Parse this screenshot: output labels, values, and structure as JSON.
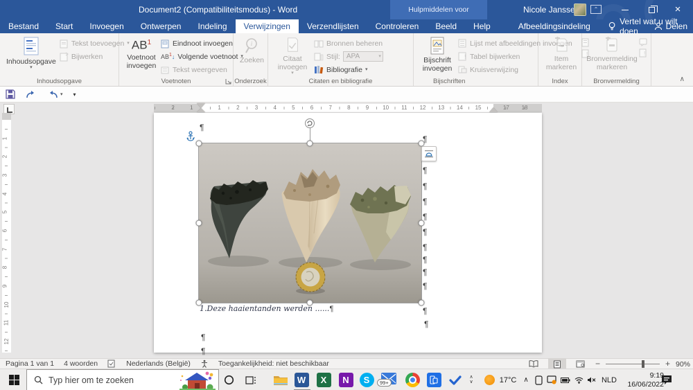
{
  "titlebar": {
    "title": "Document2 (Compatibiliteitsmodus)  -  Word",
    "context": "Hulpmiddelen voor afbeeldingen",
    "user": "Nicole Janssens"
  },
  "tabs": [
    "Bestand",
    "Start",
    "Invoegen",
    "Ontwerpen",
    "Indeling",
    "Verwijzingen",
    "Verzendlijsten",
    "Controleren",
    "Beeld",
    "Help",
    "Afbeeldingsindeling"
  ],
  "tellme": "Vertel wat u wilt doen",
  "share": "Delen",
  "ribbon": {
    "toc": {
      "main": "Inhoudsopgave",
      "add": "Tekst toevoegen",
      "update": "Bijwerken",
      "label": "Inhoudsopgave"
    },
    "fn": {
      "ab": "AB",
      "sup": "1",
      "main": "Voetnoot invoegen",
      "endnote": "Eindnoot invoegen",
      "next": "Volgende voetnoot",
      "show": "Tekst weergeven",
      "label": "Voetnoten"
    },
    "research": {
      "main": "Zoeken",
      "label": "Onderzoek"
    },
    "cit": {
      "main": "Citaat invoegen",
      "manage": "Bronnen beheren",
      "style": "Stijl:",
      "style_value": "APA",
      "biblio": "Bibliografie",
      "label": "Citaten en bibliografie"
    },
    "cap": {
      "main": "Bijschrift invoegen",
      "list": "Lijst met afbeeldingen invoegen",
      "update": "Tabel bijwerken",
      "cross": "Kruisverwijzing",
      "label": "Bijschriften"
    },
    "index": {
      "main": "Item markeren",
      "label": "Index"
    },
    "source": {
      "main": "Bronvermelding markeren",
      "label": "Bronvermelding"
    }
  },
  "ruler": {
    "h_left": [
      "2",
      "1"
    ],
    "h_mid": [
      "1",
      "2",
      "3",
      "4",
      "5",
      "6",
      "7",
      "8",
      "9",
      "10",
      "11",
      "12",
      "13",
      "14",
      "15"
    ],
    "h_right": [
      "17",
      "18"
    ],
    "v": [
      "1",
      "2",
      "3",
      "4",
      "5",
      "6",
      "7",
      "8",
      "9",
      "10",
      "11",
      "12"
    ]
  },
  "doc": {
    "caption": "1.Deze haaientanden werden ......",
    "pilcrow": "¶"
  },
  "statusbar": {
    "page": "Pagina 1 van 1",
    "words": "4 woorden",
    "language": "Nederlands (België)",
    "accessibility": "Toegankelijkheid: niet beschikbaar",
    "zoom": "90%",
    "zoom_minus": "−",
    "zoom_plus": "+"
  },
  "taskbar": {
    "search": "Typ hier om te zoeken",
    "mail_badge": "99+",
    "temp": "17°C",
    "lang": "NLD",
    "time": "9:19",
    "date": "16/06/2022"
  },
  "colors": {
    "titlebar_blue": "#2b579a",
    "context_blue": "#3f6db5",
    "ribbon_bg": "#f4f3f2",
    "doc_bg": "#e7e6e6",
    "taskbar_bg": "#eeedec"
  }
}
